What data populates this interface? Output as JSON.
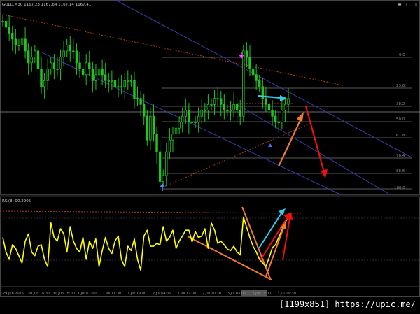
{
  "window": {
    "title": "GOLD,M30  1167.23 1167.64 1167.14 1167.41",
    "buttons": [
      "▬",
      "□",
      "×"
    ]
  },
  "price_pane": {
    "fib_levels": [
      "0.0",
      "23.6",
      "38.2",
      "50.0",
      "61.8",
      "76.4",
      "88.6",
      "100.0"
    ]
  },
  "indicator_pane": {
    "label": "RSI(8) 90.2905"
  },
  "time_axis": {
    "labels": [
      "29 Jun 2015",
      "30 Jun 16:30",
      "30 Jun 18:00",
      "1 Jul 01:00",
      "1 Jul 11:30",
      "1 Jul 19:00",
      "2 Jul 04:00",
      "2 Jul 12:00",
      "2 Jul 20:30",
      "3 Jul 05:00",
      "3 Jul 13:00",
      "3 Jul 19:30"
    ]
  },
  "watermark": "[1199x851] https://upic.me/",
  "colors": {
    "background": "#000000",
    "candles": "#22c422",
    "rsi_line": "#ffff00",
    "channel_lines": "#3a3aa8",
    "fib_lines": "#5a5a5a",
    "dotted_trend": "#b04010",
    "arrow_cyan": "#33ccee",
    "arrow_orange": "#f07a30",
    "arrow_red": "#ee1010",
    "marker_blue": "#4488ff",
    "marker_magenta": "#ff40ff"
  },
  "chart_data": {
    "type": "line",
    "symbol": "GOLD",
    "timeframe": "M30",
    "series": [
      {
        "name": "GOLD",
        "values": [
          1180,
          1179,
          1178,
          1177,
          1176,
          1176,
          1177,
          1175,
          1173,
          1174,
          1175,
          1172,
          1169,
          1170,
          1172,
          1173,
          1172,
          1172,
          1174,
          1175,
          1176,
          1175,
          1175,
          1173,
          1172,
          1171,
          1173,
          1172,
          1170,
          1171,
          1172,
          1171,
          1170,
          1170,
          1170,
          1169,
          1169,
          1169,
          1170,
          1170,
          1170,
          1167,
          1167,
          1166,
          1164,
          1160,
          1164,
          1161,
          1158,
          1153,
          1154,
          1158,
          1160,
          1161,
          1162,
          1163,
          1164,
          1165,
          1163,
          1163,
          1163,
          1164,
          1165,
          1165,
          1166,
          1166,
          1167,
          1167,
          1166,
          1165,
          1165,
          1165,
          1166,
          1165,
          1164,
          1175,
          1174,
          1172,
          1171,
          1170,
          1169,
          1167,
          1166,
          1165,
          1164,
          1163,
          1163,
          1165,
          1166,
          1167
        ]
      },
      {
        "name": "RSI(8)",
        "values": [
          60,
          40,
          30,
          50,
          45,
          35,
          25,
          55,
          65,
          40,
          35,
          48,
          50,
          30,
          20,
          80,
          60,
          55,
          72,
          65,
          40,
          75,
          55,
          45,
          40,
          60,
          30,
          55,
          45,
          58,
          20,
          42,
          60,
          45,
          38,
          55,
          62,
          30,
          20,
          48,
          42,
          58,
          30,
          15,
          62,
          70,
          48,
          48,
          52,
          50,
          75,
          55,
          60,
          70,
          45,
          55,
          62,
          70,
          70,
          54,
          68,
          60,
          62,
          72,
          45,
          80,
          70,
          52,
          55,
          50,
          44,
          42,
          48,
          40,
          36,
          88,
          74,
          60,
          48,
          40,
          30,
          25,
          20,
          32,
          46,
          50,
          60,
          70,
          80,
          90
        ]
      }
    ],
    "fib_levels": [
      0.0,
      23.6,
      38.2,
      50.0,
      61.8,
      76.4,
      88.6,
      100.0
    ],
    "rsi_last": 90.2905,
    "rsi_ylim": [
      0,
      100
    ],
    "grid": false,
    "legend": "none"
  }
}
